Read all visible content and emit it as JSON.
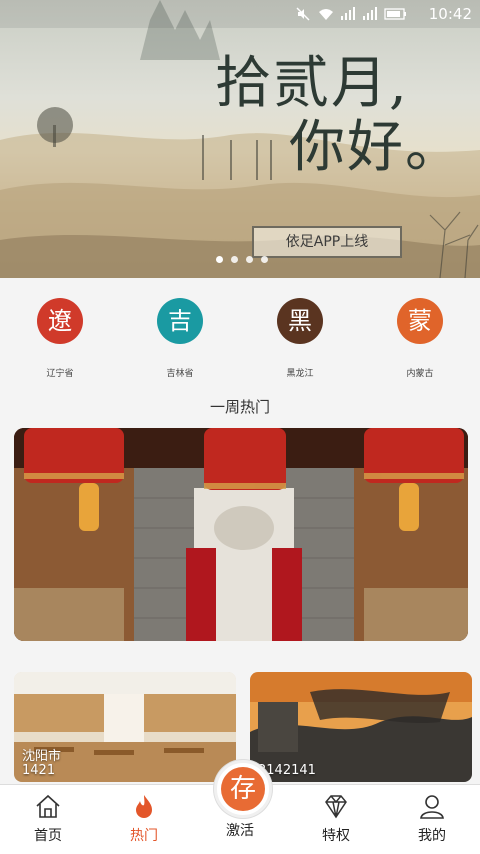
{
  "status_bar": {
    "time": "10:42"
  },
  "banner": {
    "title_line1": "拾贰月,",
    "title_line2": "你好。",
    "button_label": "依足APP上线",
    "slides": 4,
    "active_slide": 1
  },
  "provinces": [
    {
      "glyph": "遼",
      "label": "辽宁省",
      "color": "#d03a2a"
    },
    {
      "glyph": "吉",
      "label": "吉林省",
      "color": "#1a9aa2"
    },
    {
      "glyph": "黑",
      "label": "黑龙江",
      "color": "#5a3420"
    },
    {
      "glyph": "蒙",
      "label": "内蒙古",
      "color": "#e0642a"
    }
  ],
  "section": {
    "title": "一周热门"
  },
  "cards": [
    {
      "caption_line1": "沈阳市",
      "caption_line2": "1421"
    },
    {
      "caption_line1": "2142141",
      "caption_line2": ""
    }
  ],
  "tabs": [
    {
      "label": "首页",
      "icon": "home-icon"
    },
    {
      "label": "热门",
      "icon": "flame-icon",
      "active": true
    },
    {
      "label": "激活",
      "icon": "activate-icon",
      "center_glyph": "存"
    },
    {
      "label": "特权",
      "icon": "diamond-icon"
    },
    {
      "label": "我的",
      "icon": "user-icon"
    }
  ]
}
